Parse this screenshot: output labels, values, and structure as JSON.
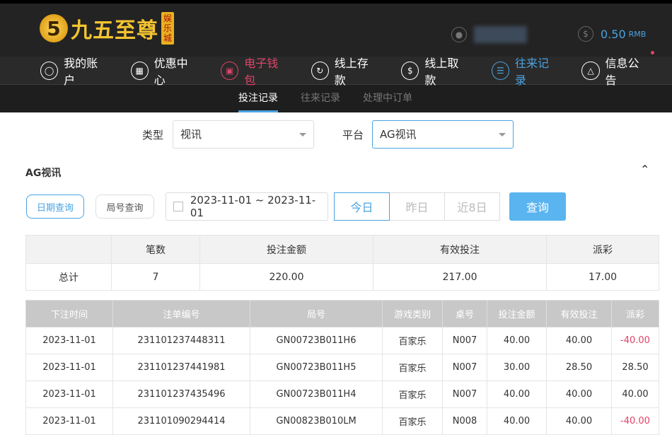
{
  "brand": {
    "logo_mark": "5",
    "name": "九五至尊",
    "badge": "娱乐城"
  },
  "account": {
    "balance": "0.50",
    "currency": "RMB"
  },
  "nav": [
    {
      "label": "我的账户",
      "icon": "user-icon"
    },
    {
      "label": "优惠中心",
      "icon": "gift-icon"
    },
    {
      "label": "电子钱包",
      "icon": "wallet-icon",
      "color": "#e0436a"
    },
    {
      "label": "线上存款",
      "icon": "deposit-icon"
    },
    {
      "label": "线上取款",
      "icon": "withdraw-icon"
    },
    {
      "label": "往来记录",
      "icon": "records-icon",
      "color": "#4aa3e0"
    },
    {
      "label": "信息公告",
      "icon": "bell-icon"
    }
  ],
  "subtabs": [
    "投注记录",
    "往来记录",
    "处理中订单"
  ],
  "filters": {
    "type_label": "类型",
    "type_value": "视讯",
    "platform_label": "平台",
    "platform_value": "AG视讯"
  },
  "section_title": "AG视讯",
  "query": {
    "date_query": "日期查询",
    "round_query": "局号查询",
    "date_range": "2023-11-01 ~ 2023-11-01",
    "today": "今日",
    "yesterday": "昨日",
    "last8": "近8日",
    "search": "查询"
  },
  "summary": {
    "headers": [
      "",
      "笔数",
      "投注金额",
      "有效投注",
      "派彩"
    ],
    "row": [
      "总计",
      "7",
      "220.00",
      "217.00",
      "17.00"
    ]
  },
  "records": {
    "headers": [
      "下注时间",
      "注单编号",
      "局号",
      "游戏类别",
      "桌号",
      "投注金额",
      "有效投注",
      "派彩"
    ],
    "rows": [
      [
        "2023-11-01",
        "231101237448311",
        "GN00723B011H6",
        "百家乐",
        "N007",
        "40.00",
        "40.00",
        "-40.00"
      ],
      [
        "2023-11-01",
        "231101237441981",
        "GN00723B011H5",
        "百家乐",
        "N007",
        "30.00",
        "28.50",
        "28.50"
      ],
      [
        "2023-11-01",
        "231101237435496",
        "GN00723B011H4",
        "百家乐",
        "N007",
        "40.00",
        "40.00",
        "40.00"
      ],
      [
        "2023-11-01",
        "231101090294414",
        "GN00823B010LM",
        "百家乐",
        "N008",
        "40.00",
        "40.00",
        "-40.00"
      ]
    ]
  },
  "colors": {
    "accent": "#4aa3e0",
    "negative": "#e0436a",
    "gold": "#f4c430"
  }
}
